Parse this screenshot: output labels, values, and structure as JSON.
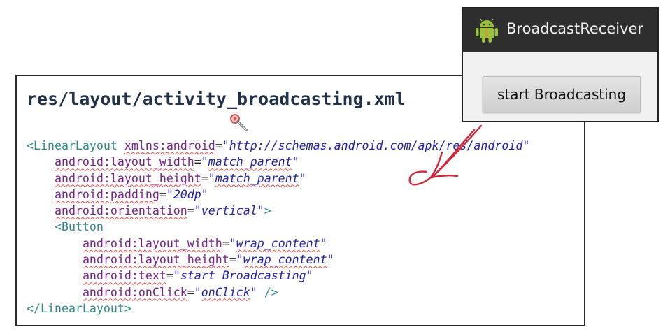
{
  "slide": {
    "file_title": "res/layout/activity_broadcasting.xml"
  },
  "code_lines": [
    [
      {
        "t": "tag",
        "s": "<LinearLayout"
      },
      {
        "t": "sp",
        "s": " "
      },
      {
        "t": "attr",
        "s": "xmlns:android"
      },
      {
        "t": "eq",
        "s": "="
      },
      {
        "t": "val",
        "s": "\"http://schemas.android.com/apk/res/android\""
      }
    ],
    [
      {
        "t": "sp",
        "s": "    "
      },
      {
        "t": "attr",
        "s": "android:layout_width"
      },
      {
        "t": "eq",
        "s": "="
      },
      {
        "t": "val",
        "s": "\""
      },
      {
        "t": "valsq",
        "s": "match_parent"
      },
      {
        "t": "val",
        "s": "\""
      }
    ],
    [
      {
        "t": "sp",
        "s": "    "
      },
      {
        "t": "attr",
        "s": "android:layout_height"
      },
      {
        "t": "eq",
        "s": "="
      },
      {
        "t": "val",
        "s": "\""
      },
      {
        "t": "valsq",
        "s": "match_parent"
      },
      {
        "t": "val",
        "s": "\""
      }
    ],
    [
      {
        "t": "sp",
        "s": "    "
      },
      {
        "t": "attr",
        "s": "android:padding"
      },
      {
        "t": "eq",
        "s": "="
      },
      {
        "t": "val",
        "s": "\"20dp\""
      }
    ],
    [
      {
        "t": "sp",
        "s": "    "
      },
      {
        "t": "attr",
        "s": "android:orientation"
      },
      {
        "t": "eq",
        "s": "="
      },
      {
        "t": "val",
        "s": "\"vertical\""
      },
      {
        "t": "punct",
        "s": ">"
      }
    ],
    [
      {
        "t": "sp",
        "s": "    "
      },
      {
        "t": "tag",
        "s": "<Button"
      }
    ],
    [
      {
        "t": "sp",
        "s": "        "
      },
      {
        "t": "attr",
        "s": "android:layout_width"
      },
      {
        "t": "eq",
        "s": "="
      },
      {
        "t": "val",
        "s": "\""
      },
      {
        "t": "valsq",
        "s": "wrap_content"
      },
      {
        "t": "val",
        "s": "\""
      }
    ],
    [
      {
        "t": "sp",
        "s": "        "
      },
      {
        "t": "attr",
        "s": "android:layout_height"
      },
      {
        "t": "eq",
        "s": "="
      },
      {
        "t": "val",
        "s": "\""
      },
      {
        "t": "valsq",
        "s": "wrap_content"
      },
      {
        "t": "val",
        "s": "\""
      }
    ],
    [
      {
        "t": "sp",
        "s": "        "
      },
      {
        "t": "attr",
        "s": "android:text"
      },
      {
        "t": "eq",
        "s": "="
      },
      {
        "t": "val",
        "s": "\"start Broadcasting\""
      }
    ],
    [
      {
        "t": "sp",
        "s": "        "
      },
      {
        "t": "attr",
        "s": "android:onClick"
      },
      {
        "t": "eq",
        "s": "="
      },
      {
        "t": "val",
        "s": "\""
      },
      {
        "t": "valsq",
        "s": "onClick"
      },
      {
        "t": "val",
        "s": "\""
      },
      {
        "t": "punct",
        "s": " />"
      }
    ],
    [
      {
        "t": "tag",
        "s": "</LinearLayout"
      },
      {
        "t": "punct",
        "s": ">"
      }
    ]
  ],
  "emulator": {
    "app_title": "BroadcastReceiver",
    "button_label": "start Broadcasting",
    "bar_color": "#2e2e2e",
    "android_icon_color": "#9ac23c"
  },
  "icons": {
    "android": "android-robot-icon",
    "cursor": "magnifier-cursor-icon"
  },
  "annotation_color": "#d0283a"
}
